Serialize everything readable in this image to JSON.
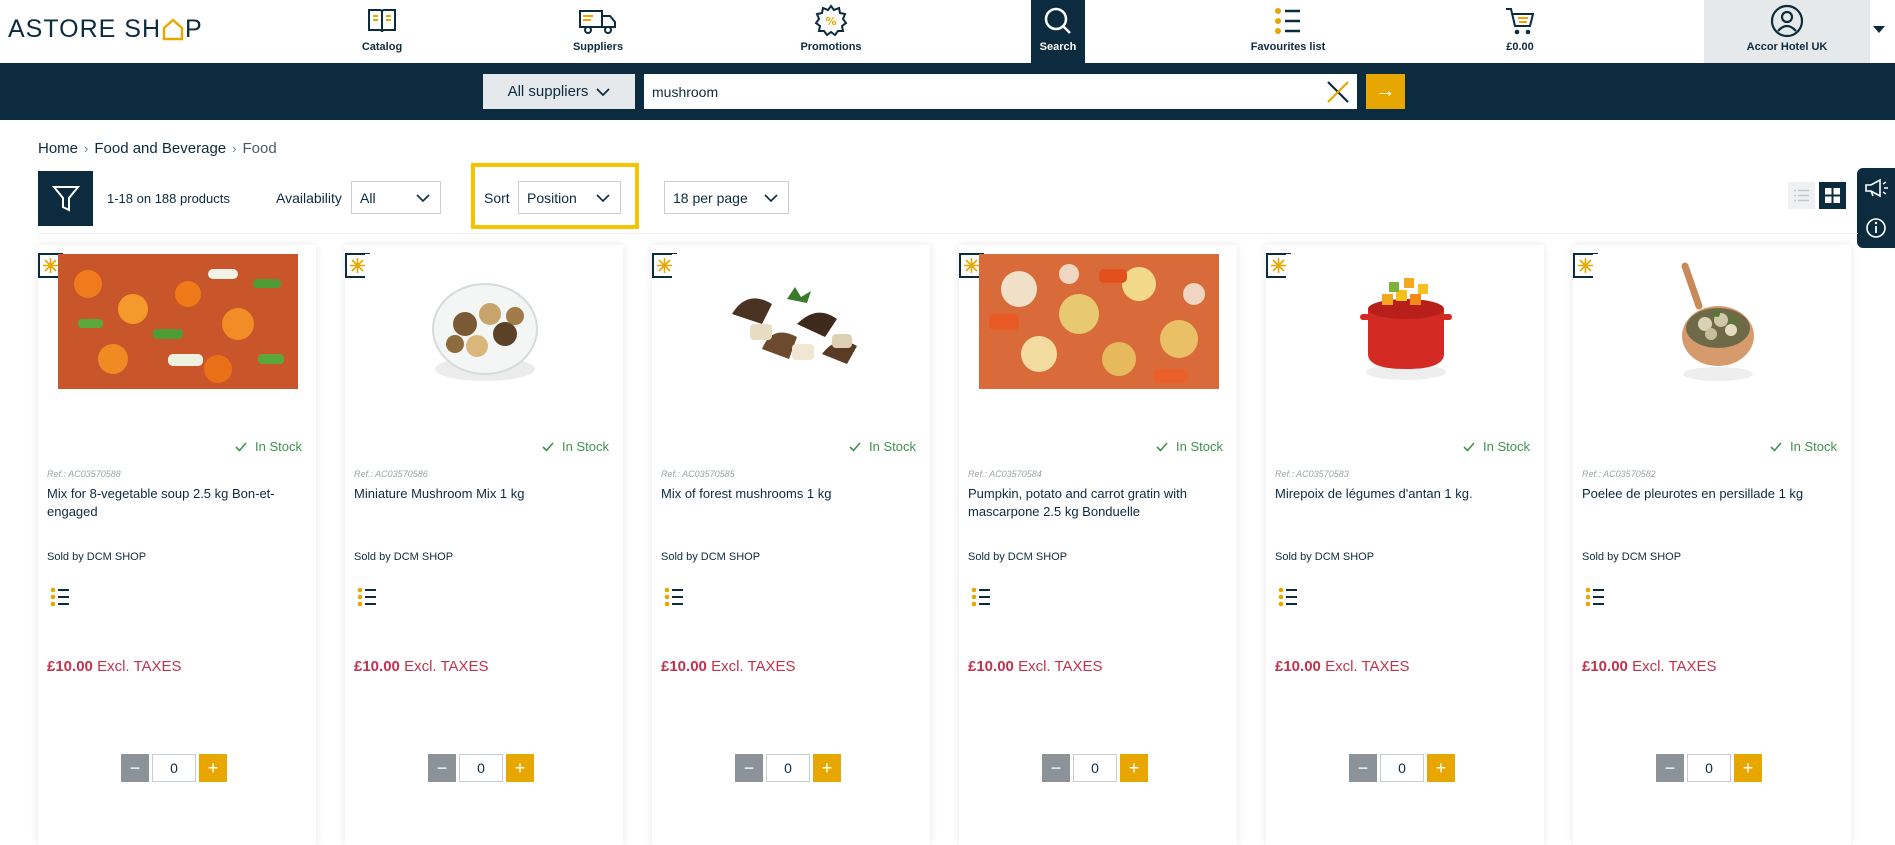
{
  "header": {
    "logo_text_left": "ASTORE SH",
    "logo_text_right": "P",
    "nav": [
      {
        "label": "Catalog",
        "icon": "book-icon"
      },
      {
        "label": "Suppliers",
        "icon": "truck-icon"
      },
      {
        "label": "Promotions",
        "icon": "percent-badge-icon"
      },
      {
        "label": "Search",
        "icon": "search-icon",
        "active": true
      },
      {
        "label": "Favourites list",
        "icon": "favourites-list-icon"
      },
      {
        "label": "£0.00",
        "icon": "cart-icon"
      }
    ],
    "account_label": "Accor Hotel UK"
  },
  "search": {
    "supplier_label": "All suppliers",
    "query": "mushroom",
    "go_label": "→"
  },
  "breadcrumb": {
    "home": "Home",
    "category": "Food and Beverage",
    "current": "Food"
  },
  "toolbar": {
    "count_text": "1-18 on 188 products",
    "availability_label": "Availability",
    "availability_value": "All",
    "sort_label": "Sort",
    "sort_value": "Position",
    "per_page_value": "18 per page"
  },
  "products": [
    {
      "stock": "In Stock",
      "ref": "Ref.: AC03570588",
      "name": "Mix for 8-vegetable soup 2.5 kg Bon-et-engaged",
      "seller": "Sold by DCM SHOP",
      "price": "£10.00",
      "tax": "Excl. TAXES",
      "qty": "0"
    },
    {
      "stock": "In Stock",
      "ref": "Ref.: AC03570586",
      "name": "Miniature Mushroom Mix 1 kg",
      "seller": "Sold by DCM SHOP",
      "price": "£10.00",
      "tax": "Excl. TAXES",
      "qty": "0"
    },
    {
      "stock": "In Stock",
      "ref": "Ref.: AC03570585",
      "name": "Mix of forest mushrooms 1 kg",
      "seller": "Sold by DCM SHOP",
      "price": "£10.00",
      "tax": "Excl. TAXES",
      "qty": "0"
    },
    {
      "stock": "In Stock",
      "ref": "Ref.: AC03570584",
      "name": "Pumpkin, potato and carrot gratin with mascarpone 2.5 kg Bonduelle",
      "seller": "Sold by DCM SHOP",
      "price": "£10.00",
      "tax": "Excl. TAXES",
      "qty": "0"
    },
    {
      "stock": "In Stock",
      "ref": "Ref.: AC03570583",
      "name": "Mirepoix de légumes d'antan 1 kg.",
      "seller": "Sold by DCM SHOP",
      "price": "£10.00",
      "tax": "Excl. TAXES",
      "qty": "0"
    },
    {
      "stock": "In Stock",
      "ref": "Ref.: AC03570582",
      "name": "Poelee de pleurotes en persillade 1 kg",
      "seller": "Sold by DCM SHOP",
      "price": "£10.00",
      "tax": "Excl. TAXES",
      "qty": "0"
    }
  ],
  "colors": {
    "navy": "#0c2b3e",
    "accent_yellow": "#e8a700",
    "price_red": "#c2324d",
    "stock_green": "#3f9151",
    "highlight": "#f5c400"
  }
}
